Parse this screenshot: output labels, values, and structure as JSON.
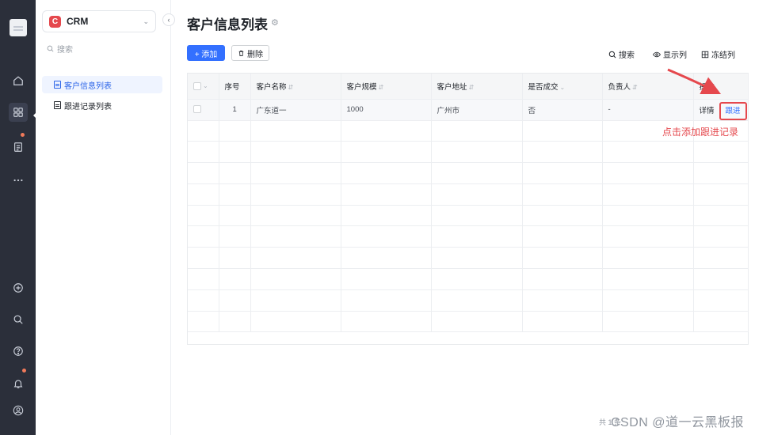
{
  "app": {
    "name": "CRM",
    "logo_letter": "C"
  },
  "sidebar": {
    "search_placeholder": "搜索",
    "items": [
      {
        "label": "客户信息列表",
        "active": true
      },
      {
        "label": "跟进记录列表",
        "active": false
      }
    ]
  },
  "page": {
    "title": "客户信息列表"
  },
  "toolbar": {
    "add_label": "+ 添加",
    "delete_label": "删除",
    "search_label": "搜索",
    "columns_label": "显示列",
    "freeze_label": "冻结列"
  },
  "table": {
    "headers": {
      "index": "序号",
      "name": "客户名称",
      "scale": "客户规模",
      "address": "客户地址",
      "deal": "是否成交",
      "owner": "负责人",
      "actions": "操作"
    },
    "rows": [
      {
        "index": "1",
        "name": "广东道一",
        "scale": "1000",
        "address": "广州市",
        "deal": "否",
        "owner": "-",
        "detail": "详情",
        "follow": "跟进"
      }
    ]
  },
  "annotation": {
    "text": "点击添加跟进记录",
    "color": "#e5484d"
  },
  "footer": {
    "left": "共 1 条",
    "right": "CSDN @道一云黑板报"
  },
  "colors": {
    "primary": "#3370ff",
    "rail": "#2b2f3a",
    "accent_red": "#e5484d"
  }
}
